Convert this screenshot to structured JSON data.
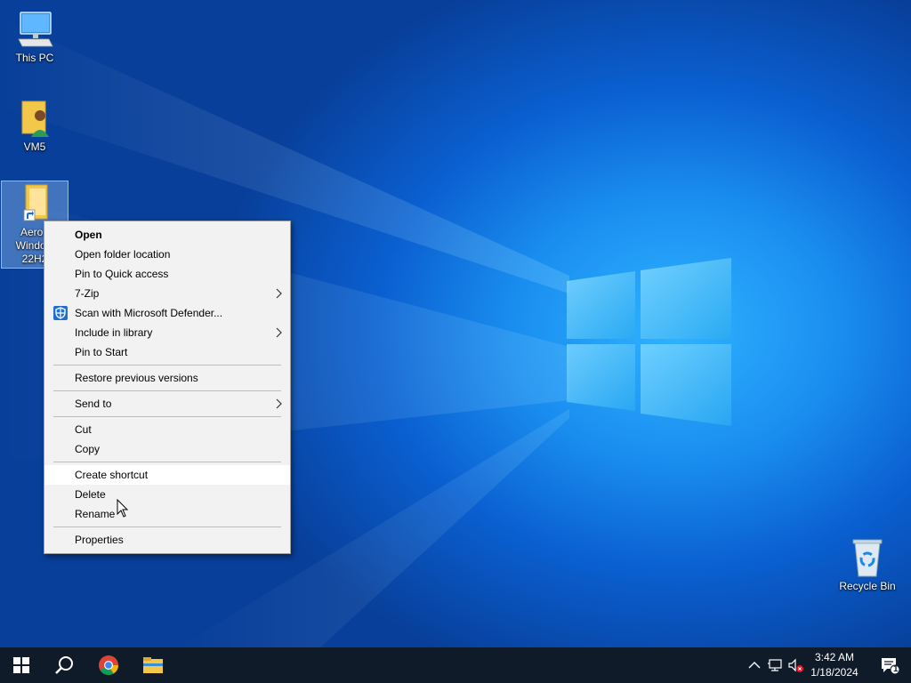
{
  "desktop": {
    "icons": [
      {
        "label": "This PC",
        "icon": "this-pc-icon"
      },
      {
        "label": "VM5",
        "icon": "user-folder-icon"
      },
      {
        "label_line1": "Aero f",
        "label_line2": "Window",
        "label_line3": "22H2",
        "icon": "folder-shortcut-icon"
      },
      {
        "label": "Recycle Bin",
        "icon": "recycle-bin-icon"
      }
    ]
  },
  "context_menu": {
    "items": {
      "open": "Open",
      "open_folder_location": "Open folder location",
      "pin_quick_access": "Pin to Quick access",
      "seven_zip": "7-Zip",
      "scan_defender": "Scan with Microsoft Defender...",
      "include_library": "Include in library",
      "pin_start": "Pin to Start",
      "restore_versions": "Restore previous versions",
      "send_to": "Send to",
      "cut": "Cut",
      "copy": "Copy",
      "create_shortcut": "Create shortcut",
      "delete": "Delete",
      "rename": "Rename",
      "properties": "Properties"
    }
  },
  "taskbar": {
    "clock_time": "3:42 AM",
    "clock_date": "1/18/2024",
    "notification_count": "1"
  },
  "colors": {
    "accent": "#0078d7",
    "taskbar": "#101b2a",
    "menu_bg": "#f2f2f2"
  }
}
